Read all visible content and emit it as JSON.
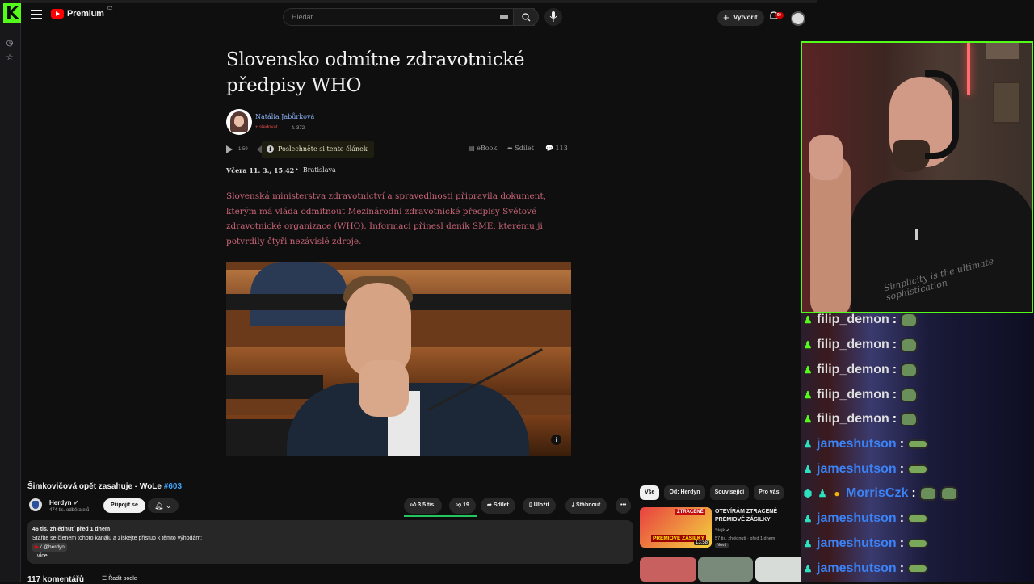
{
  "kick": {
    "logo": "K"
  },
  "youtube": {
    "brand": "Premium",
    "region": "CZ",
    "search_placeholder": "Hledat",
    "create_label": "Vytvořit",
    "notifications_badge": "9+"
  },
  "article": {
    "title": "Slovensko odmítne zdravotnické předpisy WHO",
    "author": "Natália Jabůrková",
    "follow_label": "+ sledovat",
    "followers": "372",
    "audio_duration": "1:59",
    "listen_label": "Poslechněte si tento článek",
    "ebook_label": "eBook",
    "share_label": "Sdílet",
    "comments": "113",
    "date": "Včera 11. 3., 15:42",
    "place": "Bratislava",
    "lead": "Slovenská ministerstva zdravotnictví a spravedlnosti připravila dokument, kterým má vláda odmítnout Mezinárodní zdravotnické předpisy Světové zdravotnické organizace (WHO). Informaci přinesl deník SME, kterému ji potvrdily čtyři nezávislé zdroje.",
    "photo_info": "i"
  },
  "video": {
    "title": "Šimkovičová opět zasahuje - WoLe",
    "tag": "#603",
    "channel": "Herdyn",
    "subscribers": "474 tis. odběratelů",
    "join_label": "Připojit se",
    "likes": "3,5 tis.",
    "dislikes": "19",
    "share_label": "Sdílet",
    "save_label": "Uložit",
    "download_label": "Stáhnout",
    "more_label": "•••",
    "desc_stats": "46 tis. zhlédnutí  před 1 dnem",
    "desc_text": "Staňte se členem tohoto kanálu a získejte přístup k těmto výhodám:",
    "desc_handle": "/ @herdyn",
    "desc_more": "...více",
    "comments_count": "117 komentářů",
    "sort_label": "Řadit podle"
  },
  "sidebar": {
    "chips": [
      "Vše",
      "Od: Herdyn",
      "Související",
      "Pro vás"
    ],
    "rec": {
      "title": "OTEVÍRÁM ZTRACENÉ PRÉMIOVÉ ZÁSILKY",
      "channel": "Stejk",
      "meta": "57 tis. zhlédnutí · před 1 dnem",
      "badge": "Nový",
      "duration": "13:58",
      "thumb_text1": "ZTRACENÉ",
      "thumb_text2": "PRÉMIOVÉ ZÁSILKY"
    }
  },
  "cam": {
    "shirt_text": "Simplicity is the ultimate sophistication"
  },
  "chat": {
    "separator": ":",
    "messages": [
      {
        "user": "filip_demon"
      },
      {
        "user": "filip_demon"
      },
      {
        "user": "filip_demon"
      },
      {
        "user": "filip_demon"
      },
      {
        "user": "filip_demon"
      },
      {
        "user": "jameshutson"
      },
      {
        "user": "jameshutson"
      },
      {
        "user": "MorrisCzk"
      },
      {
        "user": "jameshutson"
      },
      {
        "user": "jameshutson"
      },
      {
        "user": "jameshutson"
      }
    ]
  },
  "colors": {
    "kick_green": "#53fc18",
    "yt_red": "#ff0000",
    "link_blue": "#3ea6ff",
    "lead_rose": "#c86478"
  }
}
